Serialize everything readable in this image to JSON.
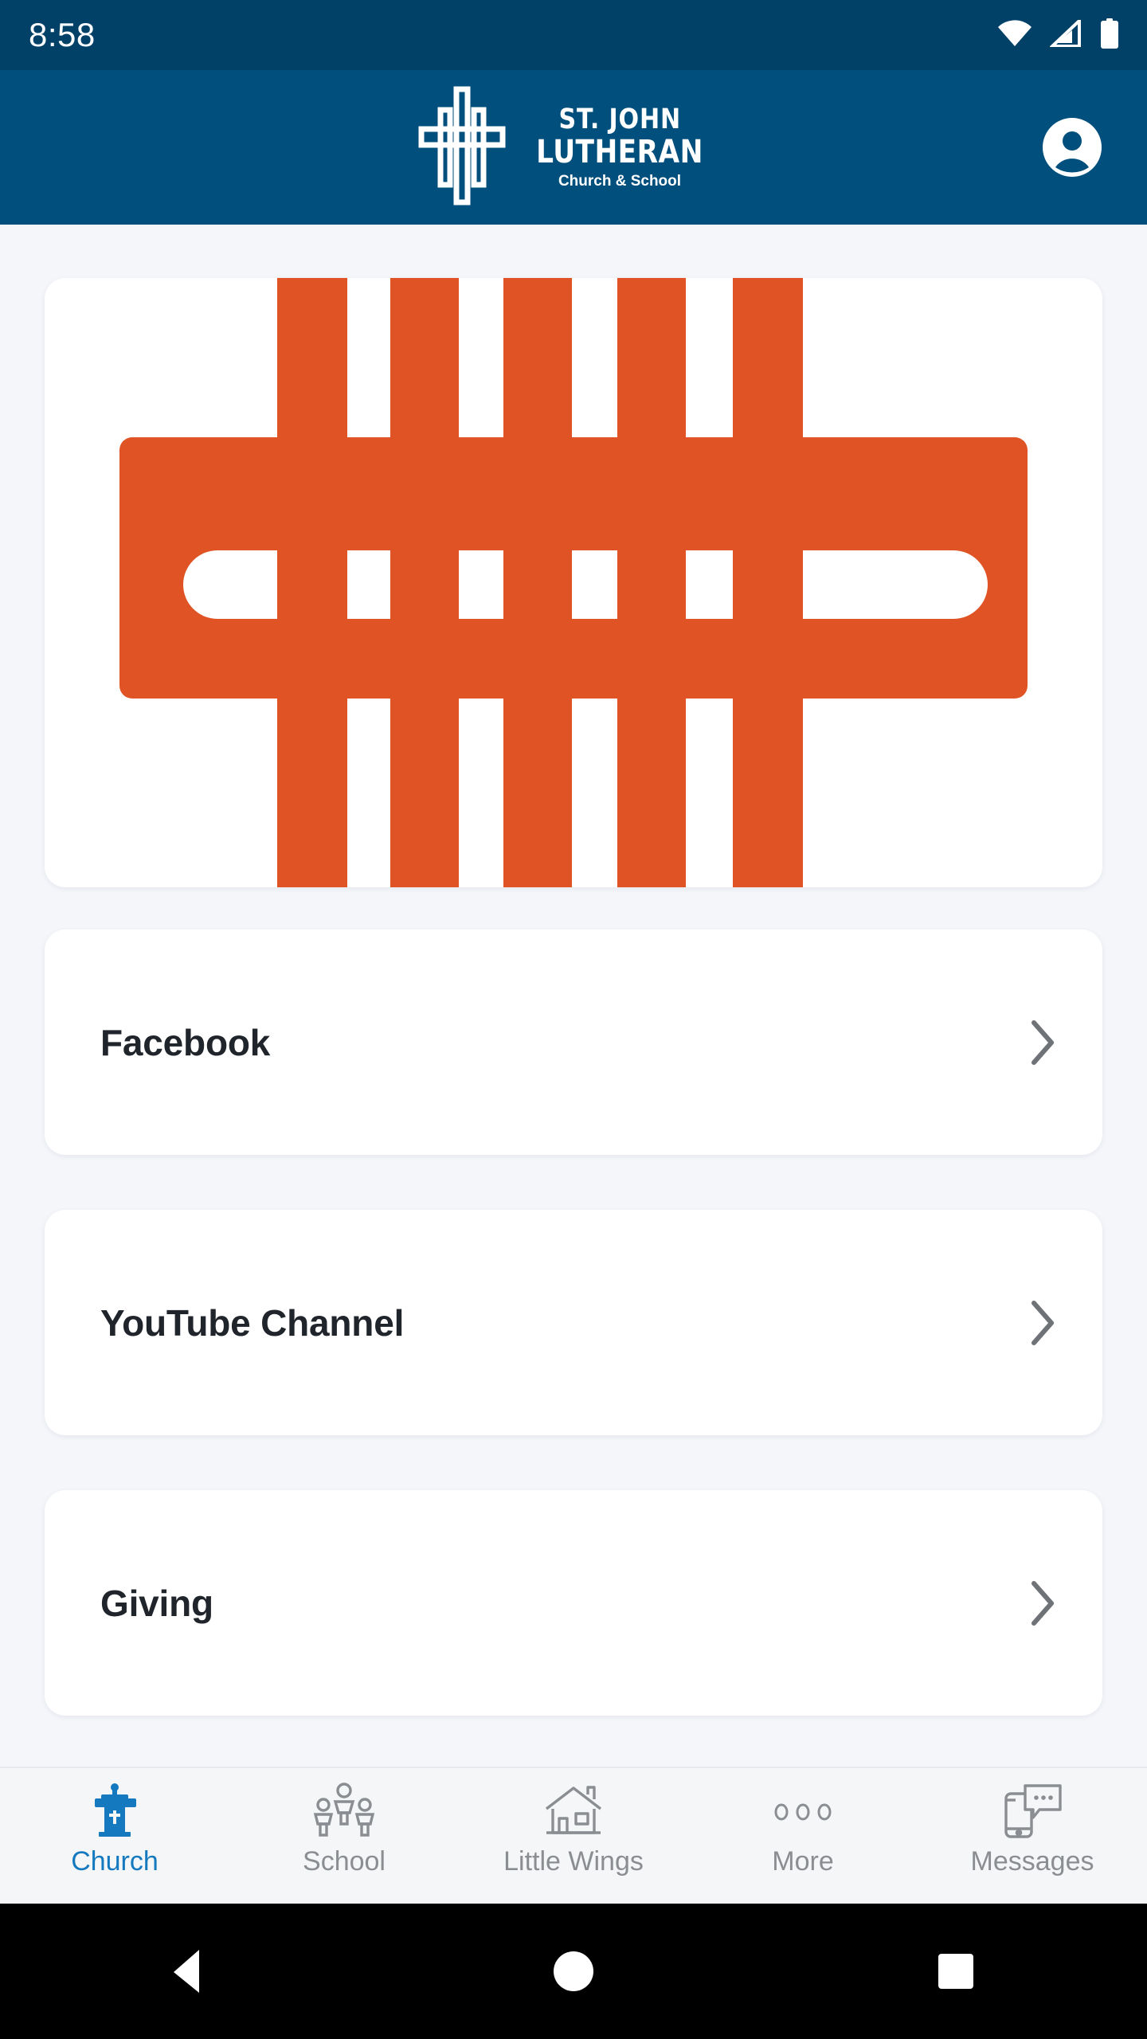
{
  "status_bar": {
    "time": "8:58",
    "icons": [
      "wifi-icon",
      "cellular-signal-icon",
      "battery-icon"
    ]
  },
  "header": {
    "brand_line1": "ST. JOHN",
    "brand_line2": "LUTHERAN",
    "brand_line3": "Church & School",
    "logo_icon": "cross-logo-icon",
    "account_icon": "account-avatar-icon",
    "background_color": "#014f7c"
  },
  "hero": {
    "alt": "st-john-lutheran-orange-cross-graphic",
    "color": "#e05324"
  },
  "rows": [
    {
      "label": "Facebook",
      "chevron": "chevron-right-icon"
    },
    {
      "label": "YouTube Channel",
      "chevron": "chevron-right-icon"
    },
    {
      "label": "Giving",
      "chevron": "chevron-right-icon"
    }
  ],
  "tabbar": {
    "active_color": "#1479be",
    "inactive_color": "#8a8d91",
    "items": [
      {
        "label": "Church",
        "icon": "pulpit-cross-icon",
        "active": true
      },
      {
        "label": "School",
        "icon": "people-group-icon",
        "active": false
      },
      {
        "label": "Little Wings",
        "icon": "house-icon",
        "active": false
      },
      {
        "label": "More",
        "icon": "three-dots-icon",
        "active": false
      },
      {
        "label": "Messages",
        "icon": "phone-message-icon",
        "active": false
      }
    ]
  },
  "android_nav": {
    "back": "back-triangle-icon",
    "home": "home-circle-icon",
    "recents": "recents-square-icon"
  }
}
